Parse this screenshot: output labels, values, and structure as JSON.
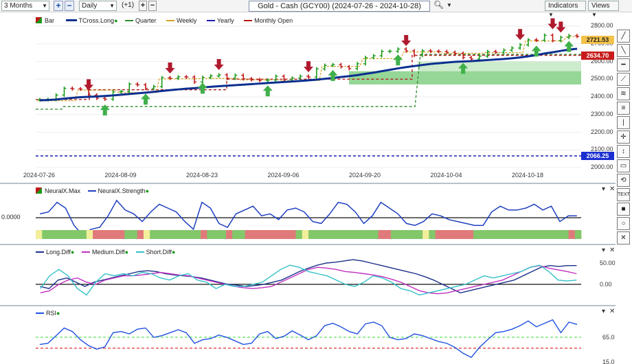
{
  "toolbar": {
    "period": "3 Months",
    "interval": "Daily",
    "offset": "(+1)",
    "title": "Gold - Cash (GCY00) (2024-07-26 - 2024-10-28)",
    "indicators_label": "Indicators",
    "views_label": "Views"
  },
  "colors": {
    "bull": "#1a9b1a",
    "bear": "#c01818",
    "tcross": "#0a2f8f",
    "quarter": "#2e8b2e",
    "weekly": "#d4a020",
    "yearly": "#1b1bb0",
    "monthly_open": "#b01010",
    "neural_strength": "#1f3fbf",
    "long_diff": "#1a2f8a",
    "medium_diff": "#c030c0",
    "short_diff": "#33c0c8",
    "rsi": "#2050e0"
  },
  "price_pane": {
    "legend": [
      "Bar",
      "TCross.Long",
      "Quarter",
      "Weekly",
      "Yearly",
      "Monthly Open"
    ],
    "price_tags": [
      "2721.53",
      "2634.70",
      "2066.25"
    ],
    "y_ticks": [
      "2800.00",
      "2700.00",
      "2600.00",
      "2500.00",
      "2400.00",
      "2300.00",
      "2200.00",
      "2100.00",
      "2000.00"
    ],
    "x_ticks": [
      "2024-07-26",
      "2024-08-09",
      "2024-08-23",
      "2024-09-06",
      "2024-09-20",
      "2024-10-04",
      "2024-10-18"
    ]
  },
  "neural_pane": {
    "legend": [
      "NeuralX.Max",
      "NeuralX.Strength"
    ],
    "zero_label": "0.0000"
  },
  "diff_pane": {
    "legend": [
      "Long.Diff",
      "Medium.Diff",
      "Short.Diff"
    ],
    "y_ticks": [
      "50.00",
      "0.00"
    ]
  },
  "rsi_pane": {
    "legend": [
      "RSI"
    ],
    "y_ticks": [
      "65.0",
      "15.0"
    ]
  },
  "chart_data": {
    "type": "line",
    "title": "Gold - Cash (GCY00) (2024-07-26 - 2024-10-28)",
    "ylim": [
      2000,
      2850
    ],
    "x": [
      "2024-07-26",
      "2024-07-29",
      "2024-07-30",
      "2024-07-31",
      "2024-08-01",
      "2024-08-02",
      "2024-08-05",
      "2024-08-06",
      "2024-08-07",
      "2024-08-08",
      "2024-08-09",
      "2024-08-12",
      "2024-08-13",
      "2024-08-14",
      "2024-08-15",
      "2024-08-16",
      "2024-08-19",
      "2024-08-20",
      "2024-08-21",
      "2024-08-22",
      "2024-08-23",
      "2024-08-26",
      "2024-08-27",
      "2024-08-28",
      "2024-08-29",
      "2024-08-30",
      "2024-09-02",
      "2024-09-03",
      "2024-09-04",
      "2024-09-05",
      "2024-09-06",
      "2024-09-09",
      "2024-09-10",
      "2024-09-11",
      "2024-09-12",
      "2024-09-13",
      "2024-09-16",
      "2024-09-17",
      "2024-09-18",
      "2024-09-19",
      "2024-09-20",
      "2024-09-23",
      "2024-09-24",
      "2024-09-25",
      "2024-09-26",
      "2024-09-27",
      "2024-09-30",
      "2024-10-01",
      "2024-10-02",
      "2024-10-03",
      "2024-10-04",
      "2024-10-07",
      "2024-10-08",
      "2024-10-09",
      "2024-10-10",
      "2024-10-11",
      "2024-10-14",
      "2024-10-15",
      "2024-10-16",
      "2024-10-17",
      "2024-10-18",
      "2024-10-21",
      "2024-10-22",
      "2024-10-23",
      "2024-10-24",
      "2024-10-25",
      "2024-10-28"
    ],
    "close": [
      2384,
      2385,
      2410,
      2448,
      2445,
      2444,
      2410,
      2392,
      2387,
      2428,
      2430,
      2472,
      2468,
      2448,
      2458,
      2508,
      2505,
      2513,
      2512,
      2484,
      2510,
      2518,
      2524,
      2505,
      2522,
      2502,
      2497,
      2493,
      2495,
      2516,
      2498,
      2506,
      2516,
      2512,
      2558,
      2578,
      2582,
      2570,
      2560,
      2587,
      2622,
      2632,
      2657,
      2658,
      2670,
      2660,
      2635,
      2660,
      2658,
      2656,
      2652,
      2646,
      2622,
      2614,
      2630,
      2656,
      2652,
      2664,
      2676,
      2694,
      2722,
      2720,
      2748,
      2718,
      2736,
      2746,
      2742
    ],
    "tcross_long": [
      2380,
      2382,
      2385,
      2390,
      2394,
      2398,
      2400,
      2402,
      2405,
      2408,
      2412,
      2416,
      2420,
      2424,
      2428,
      2433,
      2438,
      2442,
      2446,
      2449,
      2453,
      2457,
      2460,
      2463,
      2466,
      2469,
      2472,
      2475,
      2478,
      2481,
      2484,
      2487,
      2490,
      2493,
      2497,
      2502,
      2507,
      2512,
      2517,
      2523,
      2530,
      2537,
      2545,
      2553,
      2561,
      2568,
      2574,
      2580,
      2586,
      2590,
      2594,
      2598,
      2600,
      2602,
      2605,
      2608,
      2611,
      2614,
      2618,
      2623,
      2629,
      2636,
      2645,
      2652,
      2660,
      2667,
      2672
    ],
    "yearly": 2066.25,
    "monthly_open": 2634.7,
    "last_price": 2721.53,
    "series": [
      {
        "name": "NeuralX.Strength",
        "values": [
          0.2,
          0.3,
          0.8,
          0.5,
          -0.4,
          -0.9,
          -0.6,
          -0.5,
          0.1,
          0.9,
          0.4,
          0.2,
          -0.2,
          0.3,
          0.7,
          0.5,
          0.3,
          -0.2,
          -0.6,
          0.8,
          0.5,
          -0.3,
          -0.5,
          0.2,
          0.4,
          0.6,
          0.1,
          0.2,
          -0.1,
          0.4,
          0.5,
          0.3,
          -0.2,
          -0.3,
          0.2,
          0.8,
          0.7,
          0.3,
          -0.3,
          0.1,
          0.8,
          0.5,
          0.2,
          -0.3,
          -0.4,
          -0.2,
          0.2,
          0.1,
          -0.1,
          -0.2,
          -0.3,
          -0.4,
          -0.4,
          0.3,
          0.6,
          0.4,
          0.4,
          0.5,
          0.7,
          0.4,
          0.6,
          -0.2,
          0.1,
          0.1
        ]
      },
      {
        "name": "Long.Diff",
        "values": [
          -5,
          -10,
          10,
          15,
          5,
          -5,
          5,
          10,
          15,
          20,
          25,
          30,
          32,
          30,
          25,
          22,
          20,
          18,
          15,
          10,
          5,
          0,
          -2,
          -5,
          -3,
          0,
          5,
          10,
          20,
          30,
          38,
          45,
          50,
          52,
          55,
          58,
          55,
          50,
          45,
          40,
          35,
          30,
          25,
          18,
          10,
          0,
          -10,
          -20,
          -15,
          -10,
          -5,
          0,
          5,
          10,
          20,
          30,
          40,
          44,
          42,
          44,
          44
        ]
      },
      {
        "name": "Medium.Diff",
        "values": [
          -20,
          -15,
          0,
          10,
          15,
          5,
          0,
          10,
          15,
          20,
          20,
          22,
          25,
          28,
          25,
          22,
          20,
          15,
          10,
          5,
          0,
          -5,
          -8,
          -10,
          -8,
          -5,
          5,
          15,
          25,
          35,
          40,
          38,
          35,
          30,
          28,
          25,
          22,
          18,
          12,
          5,
          -5,
          -15,
          -20,
          -22,
          -20,
          -15,
          -10,
          -5,
          0,
          5,
          10,
          20,
          30,
          40,
          44,
          38,
          34,
          30,
          25
        ]
      },
      {
        "name": "Short.Diff",
        "values": [
          -10,
          20,
          35,
          20,
          -10,
          -25,
          5,
          25,
          20,
          25,
          20,
          28,
          25,
          15,
          10,
          20,
          25,
          10,
          5,
          -10,
          0,
          -5,
          -5,
          0,
          5,
          20,
          35,
          45,
          40,
          30,
          25,
          20,
          10,
          0,
          -5,
          5,
          20,
          15,
          5,
          -10,
          -15,
          -25,
          -20,
          -15,
          -10,
          -5,
          0,
          10,
          20,
          15,
          20,
          25,
          30,
          40,
          45,
          30,
          10,
          8,
          10
        ]
      },
      {
        "name": "RSI",
        "values": [
          40,
          42,
          55,
          68,
          62,
          48,
          38,
          32,
          36,
          60,
          62,
          58,
          66,
          68,
          52,
          55,
          60,
          65,
          60,
          42,
          48,
          50,
          56,
          52,
          46,
          40,
          42,
          58,
          62,
          50,
          54,
          63,
          56,
          48,
          55,
          72,
          76,
          70,
          62,
          58,
          75,
          78,
          72,
          52,
          48,
          50,
          58,
          55,
          50,
          45,
          42,
          35,
          25,
          18,
          35,
          48,
          60,
          62,
          66,
          72,
          80,
          70,
          76,
          82,
          60,
          78,
          74
        ]
      }
    ]
  }
}
